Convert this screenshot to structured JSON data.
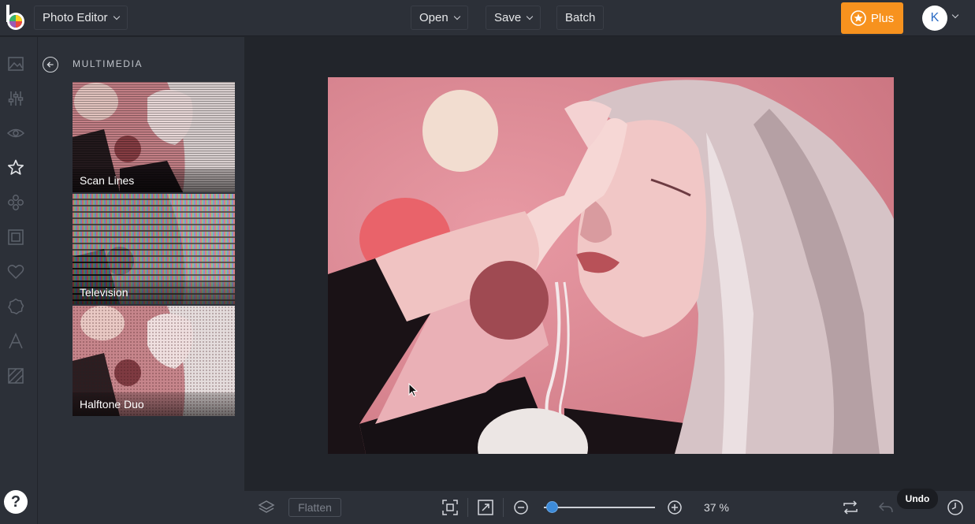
{
  "app": {
    "mode_label": "Photo Editor"
  },
  "toolbar": {
    "open_label": "Open",
    "save_label": "Save",
    "batch_label": "Batch",
    "plus_label": "Plus",
    "avatar_initial": "K"
  },
  "rail": {
    "icons": [
      "image-icon",
      "adjust-sliders-icon",
      "eye-icon",
      "star-icon",
      "shapes-icon",
      "frame-icon",
      "heart-icon",
      "badge-icon",
      "text-icon",
      "texture-icon"
    ],
    "active": "star-icon",
    "help_label": "?"
  },
  "panel": {
    "title": "MULTIMEDIA",
    "effects": [
      {
        "label": "Scan Lines"
      },
      {
        "label": "Television"
      },
      {
        "label": "Halftone Duo"
      }
    ]
  },
  "bottombar": {
    "flatten_label": "Flatten",
    "zoom_percent": "37 %",
    "zoom_level": 0.02,
    "undo_tooltip": "Undo"
  },
  "colors": {
    "accent": "#f7921e",
    "slider": "#3d8bd9",
    "background": "#22252b",
    "panel": "#2c3038"
  }
}
